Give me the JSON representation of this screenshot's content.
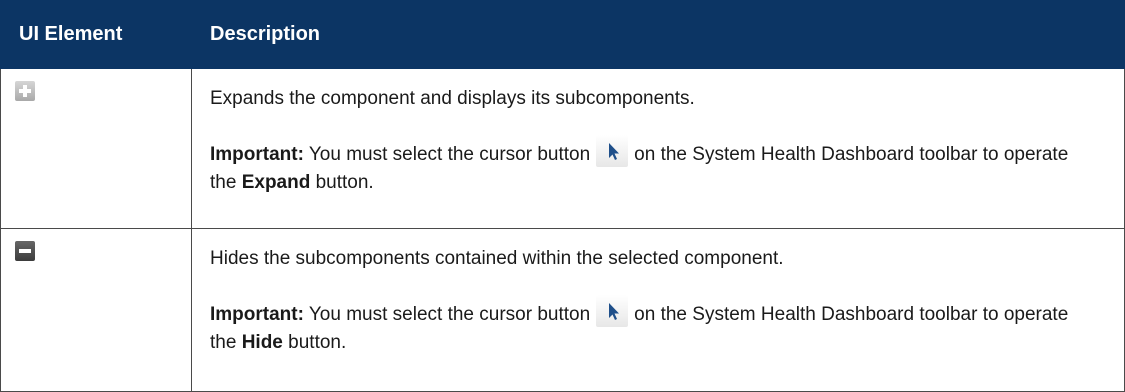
{
  "header": {
    "col1": "UI Element",
    "col2": "Description"
  },
  "rows": [
    {
      "icon": "expand-plus-icon",
      "description": "Expands the component and displays its subcomponents.",
      "note_label": "Important:",
      "note_text_before_icon": "You must select the cursor button",
      "note_icon": "cursor-arrow-icon",
      "note_text_after_icon": "on the System Health Dashboard toolbar to operate the",
      "note_button_name": "Expand",
      "note_text_end": "button."
    },
    {
      "icon": "collapse-minus-icon",
      "description": "Hides the subcomponents contained within the selected component.",
      "note_label": "Important:",
      "note_text_before_icon": "You must select the cursor button",
      "note_icon": "cursor-arrow-icon",
      "note_text_after_icon": "on the System Health Dashboard toolbar to operate the",
      "note_button_name": "Hide",
      "note_text_end": "button."
    }
  ],
  "colors": {
    "header_bg": "#0c3564",
    "header_text": "#ffffff",
    "border": "#4a4a4a",
    "cursor_icon": "#1f4f8a"
  }
}
